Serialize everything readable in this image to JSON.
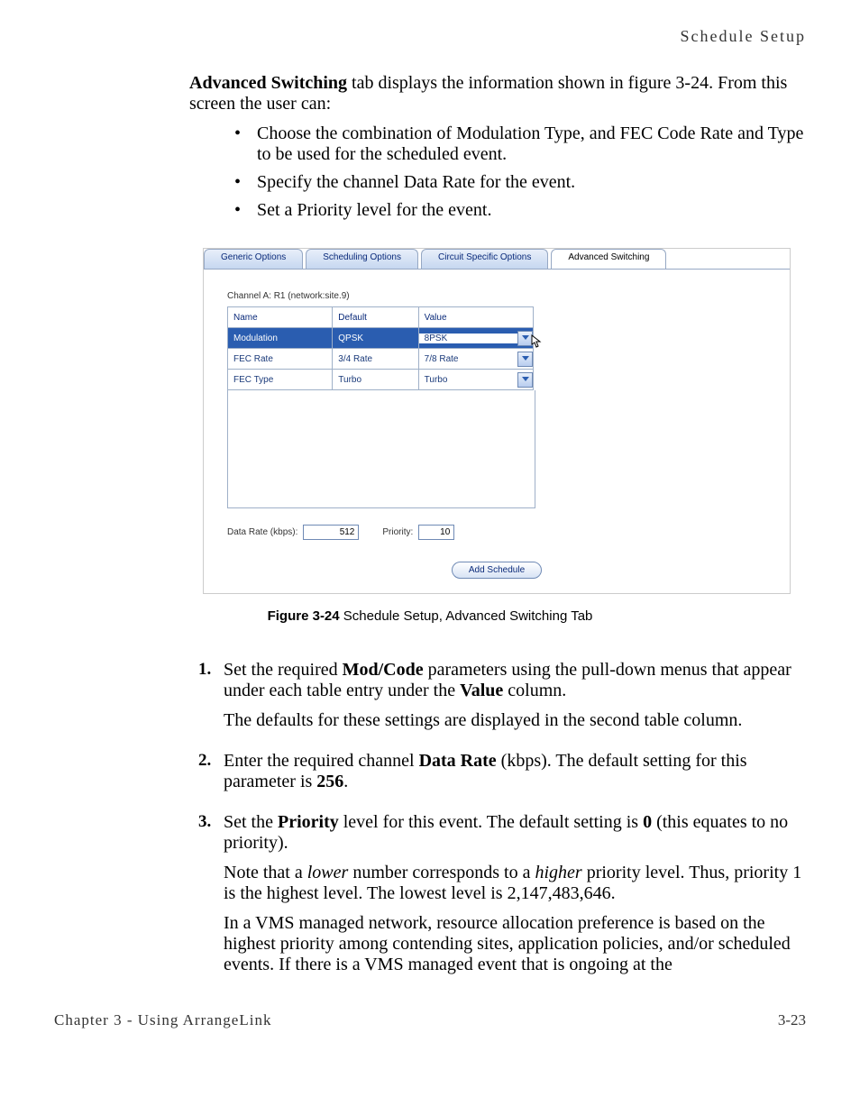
{
  "header": {
    "title": "Schedule Setup"
  },
  "intro": {
    "strong": "Advanced Switching",
    "rest": " tab displays the information shown in figure 3-24. From this screen the user can:"
  },
  "bullets": [
    "Choose the combination of Modulation Type, and FEC Code Rate and Type to be used for the scheduled event.",
    "Specify the channel Data Rate for the event.",
    "Set a Priority level for the event."
  ],
  "shot": {
    "tabs": [
      {
        "label": "Generic Options",
        "active": false
      },
      {
        "label": "Scheduling Options",
        "active": false
      },
      {
        "label": "Circuit Specific Options",
        "active": false
      },
      {
        "label": "Advanced Switching",
        "active": true
      }
    ],
    "channel_label": "Channel A: R1  (network:site.9)",
    "cols": {
      "c1": "Name",
      "c2": "Default",
      "c3": "Value"
    },
    "rows": [
      {
        "name": "Modulation",
        "def": "QPSK",
        "val": "8PSK",
        "selected": true,
        "cursor": true
      },
      {
        "name": "FEC Rate",
        "def": "3/4 Rate",
        "val": "7/8 Rate",
        "selected": false
      },
      {
        "name": "FEC Type",
        "def": "Turbo",
        "val": "Turbo",
        "selected": false
      }
    ],
    "data_rate_label": "Data Rate (kbps):",
    "data_rate_value": "512",
    "priority_label": "Priority:",
    "priority_value": "10",
    "add_button": "Add Schedule"
  },
  "figcaption": {
    "num": "Figure 3-24",
    "text": "   Schedule Setup, Advanced Switching Tab"
  },
  "steps": {
    "s1a": "Set the required ",
    "s1b": "Mod/Code",
    "s1c": " parameters using the pull-down menus that appear under each table entry under the ",
    "s1d": "Value",
    "s1e": " column.",
    "s1f": "The defaults for these settings are displayed in the second table column.",
    "s2a": "Enter the required channel ",
    "s2b": "Data Rate",
    "s2c": " (kbps). The default setting for this parameter is ",
    "s2d": "256",
    "s2e": ".",
    "s3a": "Set the ",
    "s3b": "Priority",
    "s3c": " level for this event. The default setting is ",
    "s3d": "0",
    "s3e": " (this equates to no priority).",
    "s3f1": "Note that a ",
    "s3f2": "lower",
    "s3f3": " number corresponds to a ",
    "s3f4": "higher",
    "s3f5": " priority level. Thus, priority 1 is the highest level. The lowest level is 2,147,483,646.",
    "s3g": "In a VMS managed network, resource allocation preference is based on the highest priority among contending sites, application policies, and/or scheduled events. If there is a VMS managed event that is ongoing at the"
  },
  "footer": {
    "left": "Chapter 3 - Using ArrangeLink",
    "right": "3-23"
  }
}
